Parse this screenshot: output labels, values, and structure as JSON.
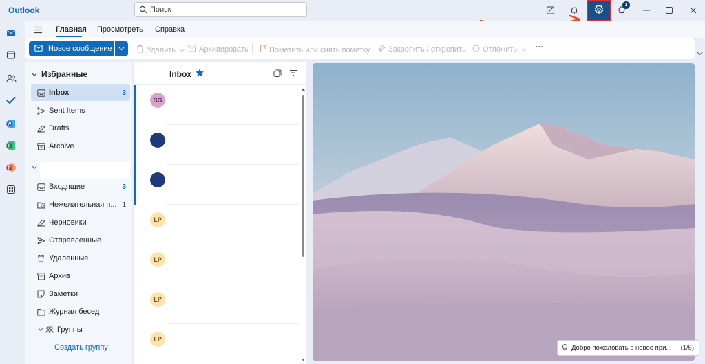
{
  "app": {
    "title": "Outlook"
  },
  "search": {
    "placeholder": "Поиск"
  },
  "titlebar": {
    "notification_badge": "1"
  },
  "ribbon": {
    "tabs": [
      {
        "label": "Главная",
        "active": true
      },
      {
        "label": "Просмотреть",
        "active": false
      },
      {
        "label": "Справка",
        "active": false
      }
    ],
    "new_message_label": "Новое сообщение",
    "actions": {
      "delete": "Удалить",
      "archive": "Архивировать",
      "flag": "Пометить или снять пометку",
      "pin": "Закрепить / открепить",
      "snooze": "Отложить",
      "more": "···"
    }
  },
  "favorites": {
    "header": "Избранные",
    "items": [
      {
        "label": "Inbox",
        "count": "3",
        "icon": "inbox-icon",
        "selected": true
      },
      {
        "label": "Sent Items",
        "count": "",
        "icon": "send-icon"
      },
      {
        "label": "Drafts",
        "count": "",
        "icon": "drafts-icon"
      },
      {
        "label": "Archive",
        "count": "",
        "icon": "archive-icon"
      }
    ]
  },
  "account": {
    "name": "",
    "items": [
      {
        "label": "Входящие",
        "count": "3",
        "icon": "inbox-icon"
      },
      {
        "label": "Нежелательная п...",
        "count": "1",
        "icon": "junk-icon"
      },
      {
        "label": "Черновики",
        "count": "",
        "icon": "drafts-icon"
      },
      {
        "label": "Отправленные",
        "count": "",
        "icon": "send-icon"
      },
      {
        "label": "Удаленные",
        "count": "",
        "icon": "trash-icon"
      },
      {
        "label": "Архив",
        "count": "",
        "icon": "archive-icon"
      },
      {
        "label": "Заметки",
        "count": "",
        "icon": "notes-icon"
      },
      {
        "label": "Журнал бесед",
        "count": "",
        "icon": "folder-icon"
      },
      {
        "label": "Группы",
        "count": "",
        "icon": "groups-icon"
      }
    ],
    "create_group": "Создать группу"
  },
  "message_list": {
    "title": "Inbox",
    "messages": [
      {
        "initials": "SG",
        "avatar_color": "#d7a4cc",
        "text_color": "#5a1f4e",
        "unread": true
      },
      {
        "initials": "",
        "avatar_color": "#1f3a7a",
        "text_color": "#ffffff",
        "unread": true
      },
      {
        "initials": "",
        "avatar_color": "#1f3a7a",
        "text_color": "#ffffff",
        "unread": true
      },
      {
        "initials": "LP",
        "avatar_color": "#fbe3ad",
        "text_color": "#7a5410",
        "unread": false
      },
      {
        "initials": "LP",
        "avatar_color": "#fbe3ad",
        "text_color": "#7a5410",
        "unread": false
      },
      {
        "initials": "LP",
        "avatar_color": "#fbe3ad",
        "text_color": "#7a5410",
        "unread": false
      },
      {
        "initials": "LP",
        "avatar_color": "#fbe3ad",
        "text_color": "#7a5410",
        "unread": false
      }
    ]
  },
  "reading_pane": {
    "tip_text": "Добро пожаловать в новое при...",
    "tip_count": "(1/5)"
  },
  "colors": {
    "accent": "#0f6cbd",
    "settings_highlight": "#d13438",
    "annotation_arrow": "#e8492d"
  }
}
